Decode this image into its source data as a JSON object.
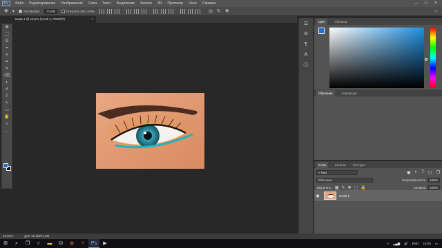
{
  "app": {
    "logo": "Ps"
  },
  "menu": [
    "Файл",
    "Редактирование",
    "Изображение",
    "Слои",
    "Текст",
    "Выделение",
    "Фильтр",
    "3D",
    "Просмотр",
    "Окно",
    "Справка"
  ],
  "options": {
    "autoselect_label": "Автовыбор:",
    "autoselect_value": "Слой",
    "transform_label": "Показать упр. элем."
  },
  "document": {
    "tab_title": "мера-1 @ 15,6% (Слой 1, RGB/8#)",
    "tab_close": "×"
  },
  "status": {
    "zoom": "15,62%",
    "doc_size": "Док: 11,4M/21,3M"
  },
  "tools": [
    "✥",
    "⬚",
    "ʘ",
    "⌖",
    "⌗",
    "✒",
    "✎",
    "⌫",
    "◐",
    "✐",
    "T",
    "↖",
    "▭",
    "✋",
    "⌕",
    "…"
  ],
  "colors": {
    "foreground": "#1d6fd2",
    "background": "#111111",
    "accent": "#6d9fe0"
  },
  "color_panel": {
    "tabs": [
      "Цвет",
      "Образцы"
    ]
  },
  "adjust_panel": {
    "tabs": [
      "Обучение",
      "Коррекция"
    ]
  },
  "layers_panel": {
    "tabs": [
      "Слои",
      "Каналы",
      "Контуры"
    ],
    "kind_filter": "Вид",
    "blend_mode": "Обычные",
    "opacity_label": "Непрозрачность:",
    "opacity_value": "100%",
    "lock_label": "Закрепить:",
    "fill_label": "Заливка:",
    "fill_value": "100%",
    "layers": [
      {
        "name": "Слой 1",
        "visible": true
      }
    ]
  },
  "taskbar": {
    "icons": [
      "start-icon",
      "search-icon",
      "task-view-icon",
      "edge-icon",
      "explorer-icon",
      "store-icon",
      "chrome-icon",
      "yandex-icon",
      "photoshop-icon",
      "media-icon"
    ],
    "lang": "ENG",
    "time": "15:00"
  }
}
